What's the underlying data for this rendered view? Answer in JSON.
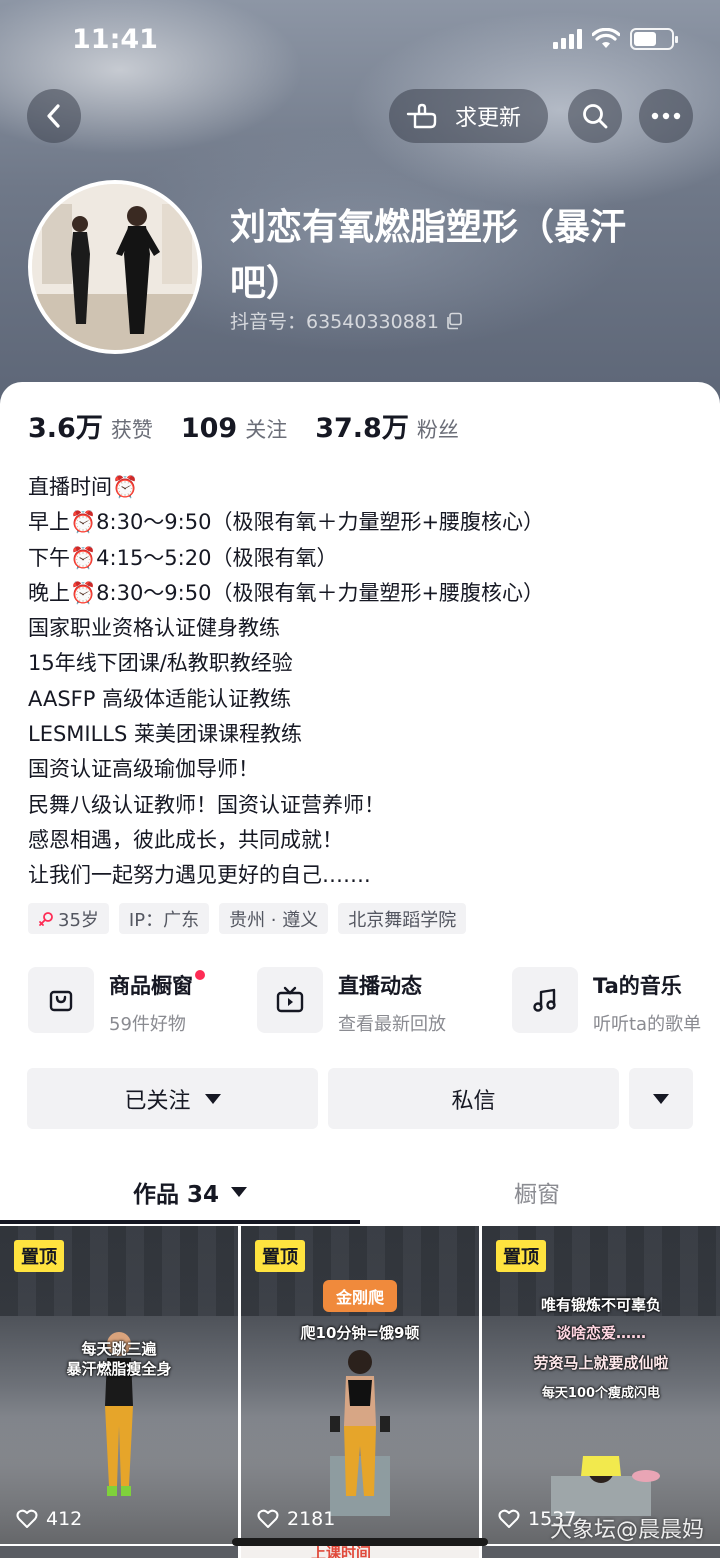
{
  "status_bar": {
    "time": "11:41"
  },
  "header": {
    "request_update_label": "求更新",
    "name": "刘恋有氧燃脂塑形（暴汗吧）",
    "douyin_id": "抖音号：63540330881"
  },
  "stats": [
    {
      "value": "3.6万",
      "label": "获赞"
    },
    {
      "value": "109",
      "label": "关注"
    },
    {
      "value": "37.8万",
      "label": "粉丝"
    }
  ],
  "bio": [
    "直播时间⏰",
    "早上⏰8:30～9:50（极限有氧＋力量塑形+腰腹核心）",
    "下午⏰4:15～5:20（极限有氧）",
    "晚上⏰8:30～9:50（极限有氧＋力量塑形+腰腹核心）",
    "国家职业资格认证健身教练",
    "15年线下团课/私教职教经验",
    "AASFP 高级体适能认证教练",
    "LESMILLS 莱美团课课程教练",
    "国资认证高级瑜伽导师！",
    "民舞八级认证教师！国资认证营养师！",
    "感恩相遇，彼此成长，共同成就！",
    "让我们一起努力遇见更好的自己……."
  ],
  "tags": [
    "35岁",
    "IP：广东",
    "贵州 · 遵义",
    "北京舞蹈学院"
  ],
  "features": [
    {
      "title": "商品橱窗",
      "subtitle": "59件好物",
      "icon": "shopping-bag-icon"
    },
    {
      "title": "直播动态",
      "subtitle": "查看最新回放",
      "icon": "tv-icon"
    },
    {
      "title": "Ta的音乐",
      "subtitle": "听听ta的歌单",
      "icon": "music-note-icon"
    }
  ],
  "actions": {
    "follow_label": "已关注",
    "message_label": "私信"
  },
  "tabs": {
    "works_label": "作品 34",
    "showcase_label": "橱窗"
  },
  "videos": [
    {
      "pinned": "置顶",
      "likes": "412",
      "captions": [
        "每天跳三遍",
        "暴汗燃脂瘦全身"
      ]
    },
    {
      "pinned": "置顶",
      "likes": "2181",
      "captions": [
        "金刚爬",
        "爬10分钟=饿9顿"
      ]
    },
    {
      "pinned": "置顶",
      "likes": "1537",
      "captions": [
        "唯有锻炼不可辜负",
        "谈啥恋爱……",
        "劳资马上就要成仙啦",
        "每天100个瘦成闪电"
      ]
    }
  ],
  "peek_text": "上课时间",
  "watermark": "大象坛@晨晨妈",
  "colors": {
    "accent_red": "#fe2c55",
    "pinned_yellow": "#ffe33f",
    "orange_caption": "#f08a3c"
  }
}
